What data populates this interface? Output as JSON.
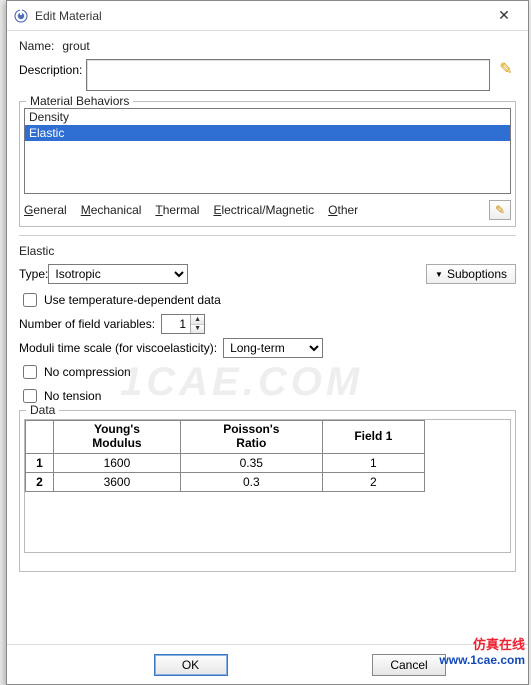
{
  "titlebar": {
    "title": "Edit Material"
  },
  "name": {
    "label": "Name:",
    "value": "grout"
  },
  "description": {
    "label": "Description:"
  },
  "behaviors": {
    "group_label": "Material Behaviors",
    "items": [
      "Density",
      "Elastic"
    ],
    "selected_index": 1
  },
  "menu": {
    "general": "General",
    "mechanical": "Mechanical",
    "thermal": "Thermal",
    "electrical": "Electrical/Magnetic",
    "other": "Other"
  },
  "elastic": {
    "section_title": "Elastic",
    "type_label": "Type:",
    "type_value": "Isotropic",
    "suboptions_label": "Suboptions",
    "use_temp_label": "Use temperature-dependent data",
    "use_temp_checked": false,
    "nfv_label": "Number of field variables:",
    "nfv_value": "1",
    "moduli_label": "Moduli time scale (for viscoelasticity):",
    "moduli_value": "Long-term",
    "no_compression_label": "No compression",
    "no_compression_checked": false,
    "no_tension_label": "No tension",
    "no_tension_checked": false,
    "data_label": "Data",
    "columns": [
      "Young's\nModulus",
      "Poisson's\nRatio",
      "Field 1"
    ],
    "rows": [
      {
        "n": "1",
        "cells": [
          "1600",
          "0.35",
          "1"
        ]
      },
      {
        "n": "2",
        "cells": [
          "3600",
          "0.3",
          "2"
        ]
      }
    ]
  },
  "buttons": {
    "ok": "OK",
    "cancel": "Cancel"
  },
  "icons": {
    "pencil": "✎",
    "close": "✕",
    "tri_down": "▼",
    "tri_up": "▲"
  },
  "watermark": {
    "bg": "1CAE.COM",
    "line1": "仿真在线",
    "line2": "www.1cae.com"
  }
}
